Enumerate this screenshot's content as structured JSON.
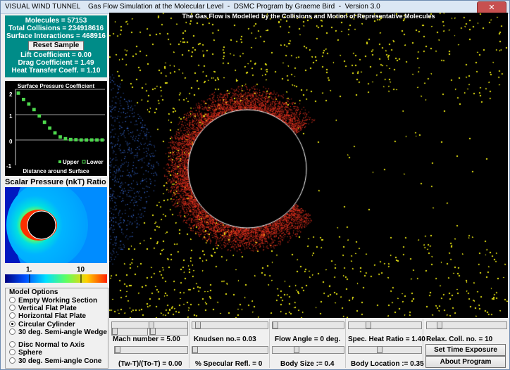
{
  "window": {
    "app_name": "VISUAL WIND TUNNEL",
    "subtitle": "Gas Flow Simulation at the Molecular Level",
    "program": "DSMC Program by Graeme Bird",
    "version": "Version 3.0",
    "close_glyph": "✕"
  },
  "stats": {
    "molecules": "Molecules = 57153",
    "total_collisions": "Total Collisions = 234918616",
    "surface_interactions": "Surface Interactions = 468916",
    "reset_label": "Reset Sample",
    "lift": "Lift Coefficient = 0.00",
    "drag": "Drag Coefficient = 1.49",
    "heat": "Heat Transfer Coeff. = 1.10"
  },
  "cp_chart": {
    "title": "Surface Pressure Coefficient",
    "xlabel": "Distance around Surface",
    "legend_upper": "Upper",
    "legend_lower": "Lower",
    "ticks": [
      "2",
      "1",
      "0",
      "-1"
    ]
  },
  "chart_data": {
    "type": "scatter",
    "title": "Surface Pressure Coefficient",
    "xlabel": "Distance around Surface",
    "ylabel": "",
    "ylim": [
      -1,
      2
    ],
    "grid": true,
    "legend": "bottom-right",
    "series": [
      {
        "name": "Upper",
        "values": [
          1.85,
          1.6,
          1.42,
          1.2,
          0.95,
          0.7,
          0.47,
          0.28,
          0.12,
          0.05,
          0.02,
          0.01,
          0.0,
          0.0,
          0.0,
          0.0,
          0.0
        ]
      },
      {
        "name": "Lower",
        "values": [
          1.85,
          1.6,
          1.42,
          1.2,
          0.95,
          0.7,
          0.47,
          0.28,
          0.12,
          0.05,
          0.02,
          0.01,
          0.0,
          0.0,
          0.0,
          0.0,
          0.0
        ]
      }
    ],
    "colors": {
      "upper": "#4dd84d",
      "lower": "#4dd84d"
    }
  },
  "scalar": {
    "label": "Scalar Pressure (nkT) Ratio",
    "cb_low": "1.",
    "cb_high": "10"
  },
  "model_options": {
    "title": "Model Options",
    "items": [
      {
        "label": "Empty Working Section",
        "selected": false
      },
      {
        "label": "Vertical Flat Plate",
        "selected": false
      },
      {
        "label": "Horizontal Flat Plate",
        "selected": false
      },
      {
        "label": "Circular Cylinder",
        "selected": true
      },
      {
        "label": "30 deg. Semi-angle Wedge",
        "selected": false
      },
      {
        "label": "Disc Normal to Axis",
        "selected": false
      },
      {
        "label": "Sphere",
        "selected": false
      },
      {
        "label": "30 deg. Semi-angle Cone",
        "selected": false
      }
    ]
  },
  "simulation": {
    "title": "The Gas Flow is Modelled by the Collisions and Motion of Representative Molecules",
    "colors": {
      "free_stream": "#3b6fe0",
      "shock": "#f2ee1a",
      "stagnation": "#e0301e"
    }
  },
  "controls": {
    "mach": "Mach number = 5.00",
    "knudsen": "Knudsen no.= 0.03",
    "flow_angle": "Flow Angle = 0 deg.",
    "heat_ratio": "Spec. Heat Ratio = 1.40",
    "relax": "Relax. Coll. no. = 10",
    "temp_ratio": "(Tw-T)/(To-T) = 0.00",
    "specular": "% Specular Refl. = 0",
    "body_size": "Body Size := 0.4",
    "body_location": "Body Location := 0.35",
    "set_time_exposure": "Set Time Exposure",
    "about_program": "About Program"
  },
  "slider_levels": {
    "mach": 0.35,
    "knudsen": 0.05,
    "heat_ratio": 0.5,
    "relax": 0.1,
    "temp_ratio": 0.0,
    "specular": 0.0,
    "body_size": 0.3,
    "body_location": 0.4
  }
}
